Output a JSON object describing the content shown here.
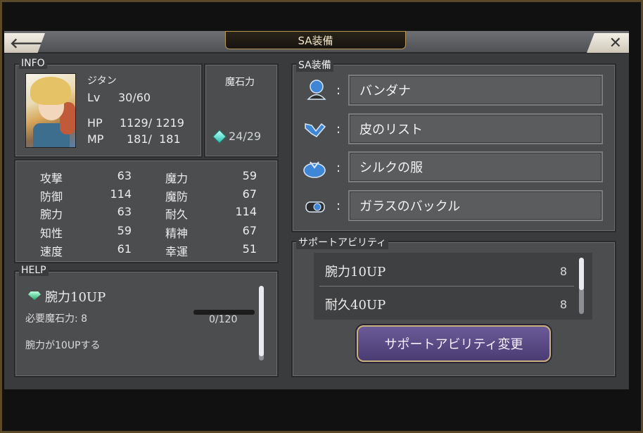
{
  "header": {
    "title": "SA装備",
    "back_glyph": "🡐",
    "close_glyph": "✕"
  },
  "info": {
    "section_label": "INFO",
    "name": "ジタン",
    "lv_label": "Lv",
    "lv_value": "30/60",
    "hp_label": "HP",
    "hp_value": "1129/ 1219",
    "mp_label": "MP",
    "mp_value": "181/  181",
    "magicite_label": "魔石力",
    "magicite_value": "24/29"
  },
  "stats": [
    {
      "label": "攻撃",
      "value": "63"
    },
    {
      "label": "魔力",
      "value": "59"
    },
    {
      "label": "防御",
      "value": "114"
    },
    {
      "label": "魔防",
      "value": "67"
    },
    {
      "label": "腕力",
      "value": "63"
    },
    {
      "label": "耐久",
      "value": "114"
    },
    {
      "label": "知性",
      "value": "59"
    },
    {
      "label": "精神",
      "value": "67"
    },
    {
      "label": "速度",
      "value": "61"
    },
    {
      "label": "幸運",
      "value": "51"
    }
  ],
  "help": {
    "section_label": "HELP",
    "ability_name": "腕力10UP",
    "required_label": "必要魔石力: 8",
    "progress_text": "0/120",
    "progress": 0.0,
    "description": "腕力が10UPする"
  },
  "sa_equipment": {
    "section_label": "SA装備",
    "slots": [
      {
        "icon": "head-icon",
        "item": "バンダナ"
      },
      {
        "icon": "arm-icon",
        "item": "皮のリスト"
      },
      {
        "icon": "body-icon",
        "item": "シルクの服"
      },
      {
        "icon": "accessory-icon",
        "item": "ガラスのバックル"
      }
    ],
    "separator": ":"
  },
  "support_ability": {
    "section_label": "サポートアビリティ",
    "items": [
      {
        "name": "腕力10UP",
        "cost": "8"
      },
      {
        "name": "耐久40UP",
        "cost": "8"
      }
    ],
    "change_button": "サポートアビリティ変更"
  },
  "colors": {
    "accent_gold": "#c9b27a",
    "button_purple": "#5a4a86",
    "panel_gray": "#4c4d4f",
    "icon_blue": "#3f86d6"
  }
}
